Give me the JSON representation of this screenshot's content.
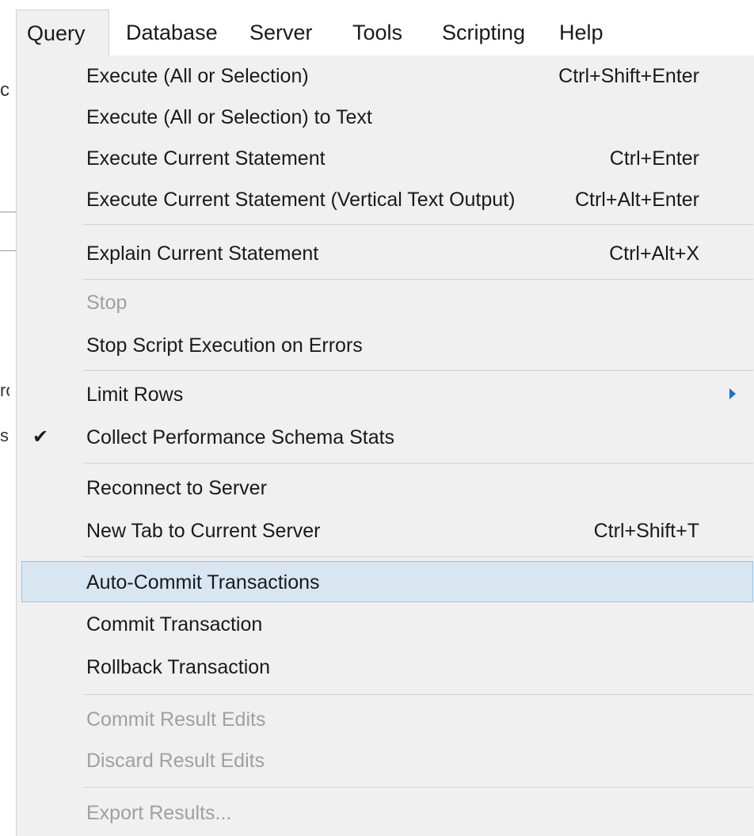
{
  "menubar": {
    "items": [
      "Query",
      "Database",
      "Server",
      "Tools",
      "Scripting",
      "Help"
    ]
  },
  "background": {
    "fragments": [
      "c",
      "ro",
      "s"
    ]
  },
  "menu": {
    "items": [
      {
        "label": "Execute (All or Selection)",
        "shortcut": "Ctrl+Shift+Enter"
      },
      {
        "label": "Execute (All or Selection) to Text",
        "shortcut": ""
      },
      {
        "label": "Execute Current Statement",
        "shortcut": "Ctrl+Enter"
      },
      {
        "label": "Execute Current Statement (Vertical Text Output)",
        "shortcut": "Ctrl+Alt+Enter"
      },
      {
        "label": "Explain Current Statement",
        "shortcut": "Ctrl+Alt+X"
      },
      {
        "label": "Stop",
        "shortcut": "",
        "disabled": true
      },
      {
        "label": "Stop Script Execution on Errors",
        "shortcut": ""
      },
      {
        "label": "Limit Rows",
        "shortcut": "",
        "submenu": true
      },
      {
        "label": "Collect Performance Schema Stats",
        "shortcut": "",
        "checked": true
      },
      {
        "label": "Reconnect to Server",
        "shortcut": ""
      },
      {
        "label": "New Tab to Current Server",
        "shortcut": "Ctrl+Shift+T"
      },
      {
        "label": "Auto-Commit Transactions",
        "shortcut": "",
        "highlighted": true
      },
      {
        "label": "Commit Transaction",
        "shortcut": ""
      },
      {
        "label": "Rollback Transaction",
        "shortcut": ""
      },
      {
        "label": "Commit Result Edits",
        "shortcut": "",
        "disabled": true
      },
      {
        "label": "Discard Result Edits",
        "shortcut": "",
        "disabled": true
      },
      {
        "label": "Export Results...",
        "shortcut": "",
        "disabled": true
      }
    ],
    "check_glyph": "✔",
    "colors": {
      "menu_bg": "#f0f0f0",
      "highlight_bg": "#d8e6f2",
      "highlight_border": "#99c3e5",
      "disabled_text": "#a0a0a0",
      "submenu_arrow": "#1b75c9"
    }
  }
}
